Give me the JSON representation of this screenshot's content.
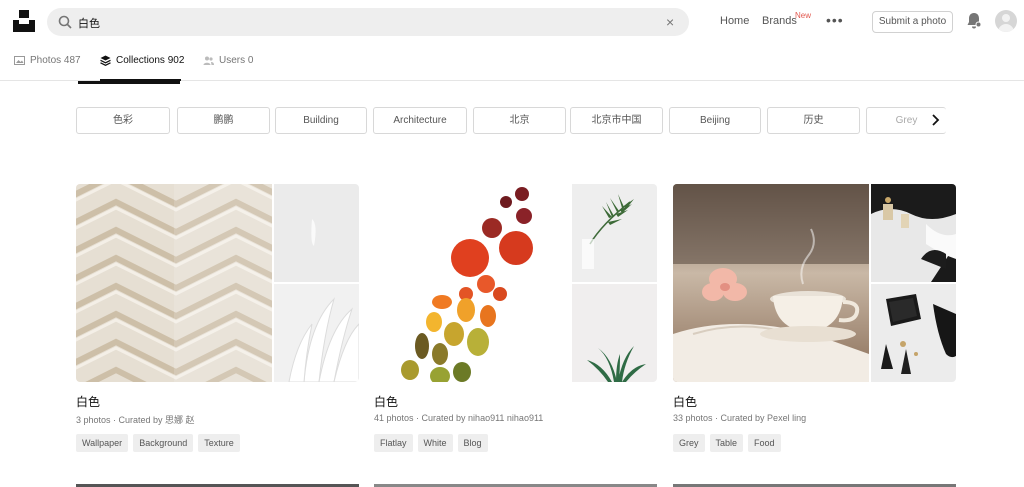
{
  "header": {
    "search_query": "白色",
    "clear_symbol": "×",
    "nav": {
      "home": "Home",
      "brands": "Brands",
      "new_badge": "New",
      "more": "•••"
    },
    "submit_label": "Submit a photo",
    "icons": [
      "unsplash-logo-icon",
      "search-icon",
      "clear-icon",
      "more-icon",
      "bell-icon",
      "avatar"
    ]
  },
  "tabs": [
    {
      "label": "Photos 487",
      "icon": "photo-icon"
    },
    {
      "label": "Collections 902",
      "icon": "collections-icon"
    },
    {
      "label": "Users 0",
      "icon": "users-icon"
    }
  ],
  "related_tags": [
    "色彩",
    "鹏鹏",
    "Building",
    "Architecture",
    "北京",
    "北京市中国",
    "Beijing",
    "历史",
    "Grey"
  ],
  "collections": [
    {
      "title": "白色",
      "meta": "3 photos · Curated by 思娜 赵",
      "tags": [
        "Wallpaper",
        "Background",
        "Texture"
      ]
    },
    {
      "title": "白色",
      "meta": "41 photos · Curated by nihao911 nihao911",
      "tags": [
        "Flatlay",
        "White",
        "Blog"
      ]
    },
    {
      "title": "白色",
      "meta": "33 photos · Curated by Pexel ling",
      "tags": [
        "Grey",
        "Table",
        "Food"
      ]
    }
  ],
  "colors": {
    "accent_new": "#e25950",
    "text_primary": "#111111",
    "text_secondary": "#767676",
    "search_bg": "#eeeeee"
  }
}
